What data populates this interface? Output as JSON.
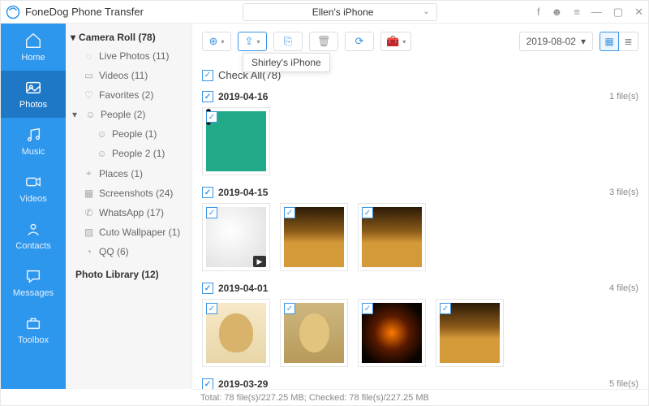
{
  "app_title": "FoneDog Phone Transfer",
  "device_selected": "Ellen's iPhone",
  "tooltip_target_device": "Shirley's iPhone",
  "date_filter": "2019-08-02",
  "nav": [
    {
      "label": "Home"
    },
    {
      "label": "Photos"
    },
    {
      "label": "Music"
    },
    {
      "label": "Videos"
    },
    {
      "label": "Contacts"
    },
    {
      "label": "Messages"
    },
    {
      "label": "Toolbox"
    }
  ],
  "sidebar": {
    "camera_roll": {
      "label": "Camera Roll (78)"
    },
    "items": [
      {
        "label": "Live Photos (11)"
      },
      {
        "label": "Videos (11)"
      },
      {
        "label": "Favorites (2)"
      },
      {
        "label": "People (2)",
        "expandable": true
      },
      {
        "label": "People (1)",
        "sub": true
      },
      {
        "label": "People 2 (1)",
        "sub": true
      },
      {
        "label": "Places (1)"
      },
      {
        "label": "Screenshots (24)"
      },
      {
        "label": "WhatsApp (17)"
      },
      {
        "label": "Cuto Wallpaper (1)"
      },
      {
        "label": "QQ (6)"
      }
    ],
    "photo_library": {
      "label": "Photo Library (12)"
    }
  },
  "check_all_label": "Check All(78)",
  "groups": [
    {
      "date": "2019-04-16",
      "count_label": "1 file(s)",
      "thumbs": [
        {
          "art": "art-phone"
        }
      ]
    },
    {
      "date": "2019-04-15",
      "count_label": "3 file(s)",
      "thumbs": [
        {
          "art": "art-mug",
          "video": true
        },
        {
          "art": "art-beer"
        },
        {
          "art": "art-beer"
        }
      ]
    },
    {
      "date": "2019-04-01",
      "count_label": "4 file(s)",
      "thumbs": [
        {
          "art": "art-puppy1"
        },
        {
          "art": "art-puppy2"
        },
        {
          "art": "art-stage"
        },
        {
          "art": "art-beer"
        }
      ]
    },
    {
      "date": "2019-03-29",
      "count_label": "5 file(s)",
      "thumbs": []
    }
  ],
  "status_text": "Total: 78 file(s)/227.25 MB; Checked: 78 file(s)/227.25 MB"
}
